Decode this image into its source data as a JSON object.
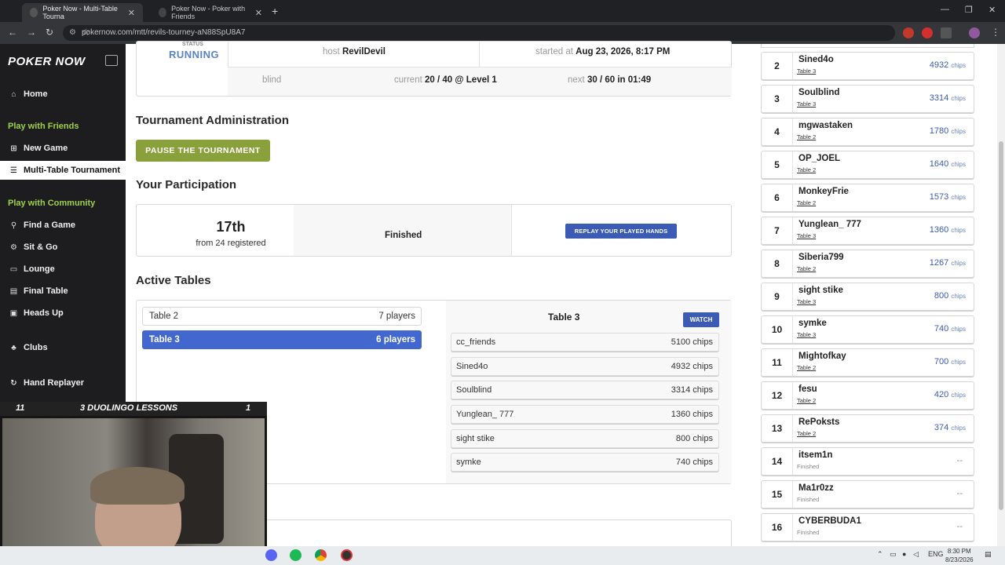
{
  "browser": {
    "tabs": [
      {
        "label": "Poker Now - Multi-Table Tourna",
        "active": true
      },
      {
        "label": "Poker Now - Poker with Friends",
        "active": false
      }
    ],
    "url": "pokernow.com/mtt/revils-tourney-aN88SpU8A7"
  },
  "sidebar": {
    "logo": "POKER NOW",
    "home": "Home",
    "section_friends": "Play with Friends",
    "new_game": "New Game",
    "mtt": "Multi-Table Tournament",
    "section_community": "Play with Community",
    "find_game": "Find a Game",
    "sit_go": "Sit & Go",
    "lounge": "Lounge",
    "final_table": "Final Table",
    "heads_up": "Heads Up",
    "clubs": "Clubs",
    "hand_replayer": "Hand Replayer"
  },
  "overlay": {
    "left": "11",
    "middle": "3 DUOLINGO LESSONS",
    "right": "1"
  },
  "status": {
    "label": "STATUS",
    "value": "RUNNING",
    "host_label": "host",
    "host": "RevilDevil",
    "started_label": "started at",
    "started": "Aug 23, 2026, 8:17 PM",
    "blind_label": "blind",
    "current_label": "current",
    "current": "20 / 40 @ Level 1",
    "next_label": "next",
    "next": "30 / 60 in 01:49"
  },
  "admin": {
    "heading": "Tournament Administration",
    "pause_button": "PAUSE THE TOURNAMENT"
  },
  "participation": {
    "heading": "Your Participation",
    "rank": "17th",
    "registered": "from 24 registered",
    "status": "Finished",
    "replay_button": "REPLAY YOUR PLAYED HANDS"
  },
  "active_tables": {
    "heading": "Active Tables",
    "tables": [
      {
        "name": "Table 2",
        "players": "7 players",
        "selected": false
      },
      {
        "name": "Table 3",
        "players": "6 players",
        "selected": true
      }
    ],
    "detail_title": "Table 3",
    "watch_button": "WATCH",
    "detail_players": [
      {
        "name": "cc_friends",
        "chips": "5100 chips"
      },
      {
        "name": "Sined4o",
        "chips": "4932 chips"
      },
      {
        "name": "Soulblind",
        "chips": "3314 chips"
      },
      {
        "name": "Yunglean_ 777",
        "chips": "1360 chips"
      },
      {
        "name": "sight stike",
        "chips": "800 chips"
      },
      {
        "name": "symke",
        "chips": "740 chips"
      }
    ]
  },
  "standings": [
    {
      "rank": "2",
      "name": "Sined4o",
      "table": "Table 3",
      "chips": "4932",
      "unit": "chips"
    },
    {
      "rank": "3",
      "name": "Soulblind",
      "table": "Table 3",
      "chips": "3314",
      "unit": "chips"
    },
    {
      "rank": "4",
      "name": "mgwastaken",
      "table": "Table 2",
      "chips": "1780",
      "unit": "chips"
    },
    {
      "rank": "5",
      "name": "OP_JOEL",
      "table": "Table 2",
      "chips": "1640",
      "unit": "chips"
    },
    {
      "rank": "6",
      "name": "MonkeyFrie",
      "table": "Table 2",
      "chips": "1573",
      "unit": "chips"
    },
    {
      "rank": "7",
      "name": "Yunglean_ 777",
      "table": "Table 3",
      "chips": "1360",
      "unit": "chips"
    },
    {
      "rank": "8",
      "name": "Siberia799",
      "table": "Table 2",
      "chips": "1267",
      "unit": "chips"
    },
    {
      "rank": "9",
      "name": "sight stike",
      "table": "Table 3",
      "chips": "800",
      "unit": "chips"
    },
    {
      "rank": "10",
      "name": "symke",
      "table": "Table 3",
      "chips": "740",
      "unit": "chips"
    },
    {
      "rank": "11",
      "name": "Mightofkay",
      "table": "Table 2",
      "chips": "700",
      "unit": "chips"
    },
    {
      "rank": "12",
      "name": "fesu",
      "table": "Table 2",
      "chips": "420",
      "unit": "chips"
    },
    {
      "rank": "13",
      "name": "RePoksts",
      "table": "Table 2",
      "chips": "374",
      "unit": "chips"
    },
    {
      "rank": "14",
      "name": "itsem1n",
      "table": "Finished",
      "chips": "--",
      "unit": ""
    },
    {
      "rank": "15",
      "name": "Ma1r0zz",
      "table": "Finished",
      "chips": "--",
      "unit": ""
    },
    {
      "rank": "16",
      "name": "CYBERBUDA1",
      "table": "Finished",
      "chips": "--",
      "unit": ""
    }
  ],
  "taskbar": {
    "lang": "ENG",
    "time": "8:30 PM",
    "date": "8/23/2026"
  }
}
